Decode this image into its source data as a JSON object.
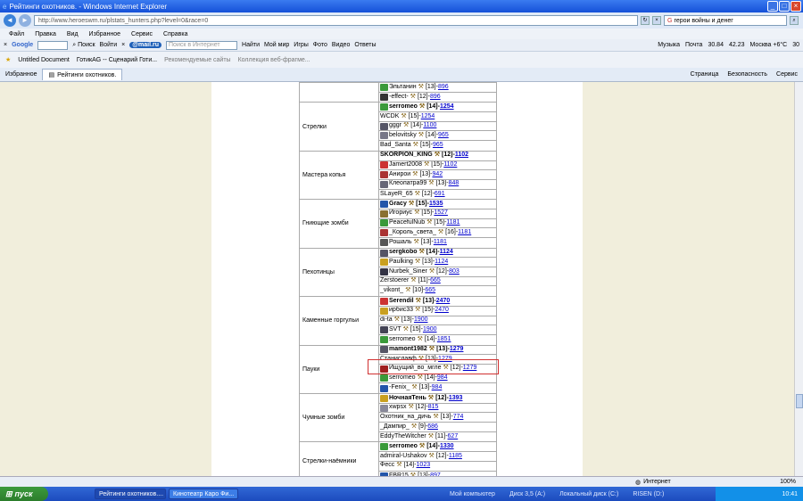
{
  "window": {
    "title": "Рейтинги охотников. - Windows Internet Explorer"
  },
  "address": {
    "url": "http://www.heroeswm.ru/plstats_hunters.php?level=0&race=0",
    "search_value": "герои войны и денег"
  },
  "menu": [
    "Файл",
    "Правка",
    "Вид",
    "Избранное",
    "Сервис",
    "Справка"
  ],
  "google_toolbar": {
    "search_label": "Поиск",
    "login_label": "Войти"
  },
  "mailru_toolbar": {
    "brand": "@mail.ru",
    "search_placeholder": "Поиск в Интернет",
    "find_label": "Найти",
    "items": [
      "Мой мир",
      "Игры",
      "Фото",
      "Видео",
      "Ответы"
    ],
    "right": [
      "Музыка",
      "Почта",
      "30.84",
      "42.23",
      "Москва +6°C",
      "30"
    ]
  },
  "favorites": {
    "label": "Избранное",
    "links": [
      "Untitled Document",
      "ГотикАG -- Сценарий Готи...",
      "Рекомендуемые сайты",
      "Коллекция веб-фрагме..."
    ]
  },
  "tab": {
    "label": "Рейтинги охотников."
  },
  "commands": [
    "Страница",
    "Безопасность",
    "Сервис"
  ],
  "ratings": [
    {
      "category": "",
      "players": [
        {
          "name": "Эльтанин",
          "level": "[13]",
          "score": "896",
          "color": "#3a9a3a"
        },
        {
          "name": "-effect-",
          "level": "[12]",
          "score": "896",
          "color": "#333"
        }
      ]
    },
    {
      "category": "Стрелки",
      "players": [
        {
          "name": "serromeo",
          "level": "[14]",
          "score": "1254",
          "color": "#3a9a3a"
        },
        {
          "name": "WCDK",
          "level": "[15]",
          "score": "1254",
          "color": ""
        },
        {
          "name": "gggr",
          "level": "[14]",
          "score": "1100",
          "color": "#556"
        },
        {
          "name": "belovitsky",
          "level": "[14]",
          "score": "965",
          "color": "#778"
        },
        {
          "name": "Bad_Santa",
          "level": "[15]",
          "score": "965",
          "color": ""
        }
      ]
    },
    {
      "category": "Мастера копья",
      "players": [
        {
          "name": "SKORPION_KING",
          "level": "[12]",
          "score": "1102",
          "color": ""
        },
        {
          "name": "Jamert2008",
          "level": "[15]",
          "score": "1102",
          "color": "#c33"
        },
        {
          "name": "Анирои",
          "level": "[13]",
          "score": "942",
          "color": "#a33"
        },
        {
          "name": "Клеопатра99",
          "level": "[13]",
          "score": "848",
          "color": "#667"
        },
        {
          "name": "SLayeR_65",
          "level": "[12]",
          "score": "691",
          "color": ""
        }
      ]
    },
    {
      "category": "Гниющие зомби",
      "players": [
        {
          "name": "Gracy",
          "level": "[15]",
          "score": "1535",
          "color": "#2255aa"
        },
        {
          "name": "Игориус",
          "level": "[15]",
          "score": "1527",
          "color": "#8a7030"
        },
        {
          "name": "PeacefulNub",
          "level": "[15]",
          "score": "1181",
          "color": "#3a9a3a"
        },
        {
          "name": "_Король_света_",
          "level": "[16]",
          "score": "1181",
          "color": "#aa3333"
        },
        {
          "name": "Рошаль",
          "level": "[13]",
          "score": "1181",
          "color": "#555"
        }
      ]
    },
    {
      "category": "Пехотинцы",
      "players": [
        {
          "name": "sergkobo",
          "level": "[14]",
          "score": "1124",
          "color": "#556"
        },
        {
          "name": "Paulking",
          "level": "[13]",
          "score": "1124",
          "color": "#c9a020"
        },
        {
          "name": "Nurbek_Siner",
          "level": "[12]",
          "score": "803",
          "color": "#334"
        },
        {
          "name": "Zerstoerer",
          "level": "[11]",
          "score": "665",
          "color": ""
        },
        {
          "name": "_vikont_",
          "level": "[10]",
          "score": "665",
          "color": ""
        }
      ]
    },
    {
      "category": "Каменные горгульи",
      "players": [
        {
          "name": "Serendil",
          "level": "[13]",
          "score": "2470",
          "color": "#c33"
        },
        {
          "name": "ирбис33",
          "level": "[15]",
          "score": "2470",
          "color": "#c9a020"
        },
        {
          "name": "di-ta",
          "level": "[13]",
          "score": "1900",
          "color": ""
        },
        {
          "name": "SVT",
          "level": "[15]",
          "score": "1900",
          "color": "#445"
        },
        {
          "name": "serromeo",
          "level": "[14]",
          "score": "1851",
          "color": "#3a9a3a"
        }
      ]
    },
    {
      "category": "Пауки",
      "players": [
        {
          "name": "mamont1982",
          "level": "[13]",
          "score": "1279",
          "color": "#556"
        },
        {
          "name": "Станиславф",
          "level": "[13]",
          "score": "1279",
          "color": ""
        },
        {
          "name": "Ищущий_во_мгле",
          "level": "[12]",
          "score": "1279",
          "color": "#a02020"
        },
        {
          "name": "serromeo",
          "level": "[14]",
          "score": "984",
          "color": "#3a9a3a"
        },
        {
          "name": "-Fenix_",
          "level": "[13]",
          "score": "984",
          "color": "#2255aa"
        }
      ]
    },
    {
      "category": "Чумные зомби",
      "players": [
        {
          "name": "НочнаяТень",
          "level": "[12]",
          "score": "1393",
          "color": "#c9a020"
        },
        {
          "name": "xwpsx",
          "level": "[12]",
          "score": "815",
          "color": "#889"
        },
        {
          "name": "Охотник_на_дичь",
          "level": "[13]",
          "score": "774",
          "color": ""
        },
        {
          "name": "_Дампир_",
          "level": "[9]",
          "score": "686",
          "color": ""
        },
        {
          "name": "EddyTheWitcher",
          "level": "[11]",
          "score": "627",
          "color": ""
        }
      ]
    },
    {
      "category": "Стрелки-наёмники",
      "players": [
        {
          "name": "serromeo",
          "level": "[14]",
          "score": "1330",
          "color": "#3a9a3a"
        },
        {
          "name": "admiral-Ushakov",
          "level": "[12]",
          "score": "1185",
          "color": ""
        },
        {
          "name": "Фесс",
          "level": "[14]",
          "score": "1023",
          "color": ""
        },
        {
          "name": "FBR15",
          "level": "[13]",
          "score": "897",
          "color": "#2255aa"
        }
      ]
    }
  ],
  "status": {
    "zone": "Интернет",
    "zoom": "100%"
  },
  "taskbar": {
    "start": "пуск",
    "buttons": [
      "Рейтинги охотников....",
      "Кинотеатр Каро Фи..."
    ],
    "items": [
      "Мой компьютер",
      "Диск 3,5 (A:)",
      "Локальный диск (C:)",
      "RISEN (D:)"
    ],
    "clock": "10:41"
  }
}
